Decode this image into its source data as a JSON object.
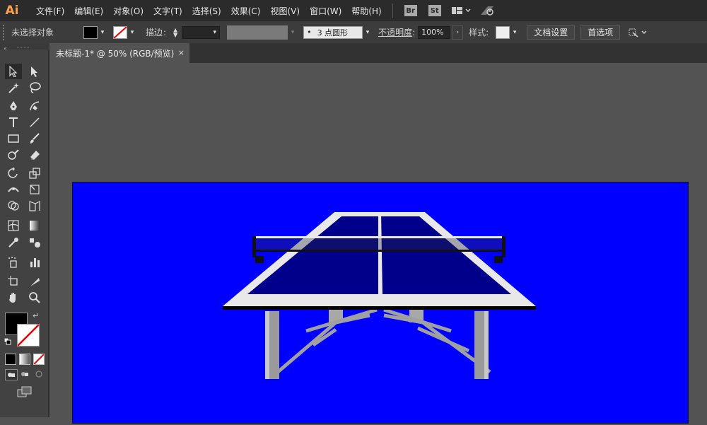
{
  "app": {
    "logo": "Ai"
  },
  "menu": [
    "文件(F)",
    "编辑(E)",
    "对象(O)",
    "文字(T)",
    "选择(S)",
    "效果(C)",
    "视图(V)",
    "窗口(W)",
    "帮助(H)"
  ],
  "menubar_badges": {
    "bridge": "Br",
    "stock": "St"
  },
  "control": {
    "no_selection": "未选择对象",
    "stroke_label": "描边",
    "brush_label": "3 点圆形",
    "opacity_label": "不透明度",
    "opacity_value": "100%",
    "style_label": "样式",
    "doc_setup_button": "文档设置",
    "preferences_button": "首选项"
  },
  "document_tab": {
    "title": "未标题-1* @ 50% (RGB/预览)",
    "close": "×"
  },
  "colors": {
    "artboard": "#0000ff",
    "table_top": "#00008a",
    "table_border": "#e8e8e8",
    "legs": "#9a9a9a",
    "accent_logo": "#f7a14a"
  }
}
